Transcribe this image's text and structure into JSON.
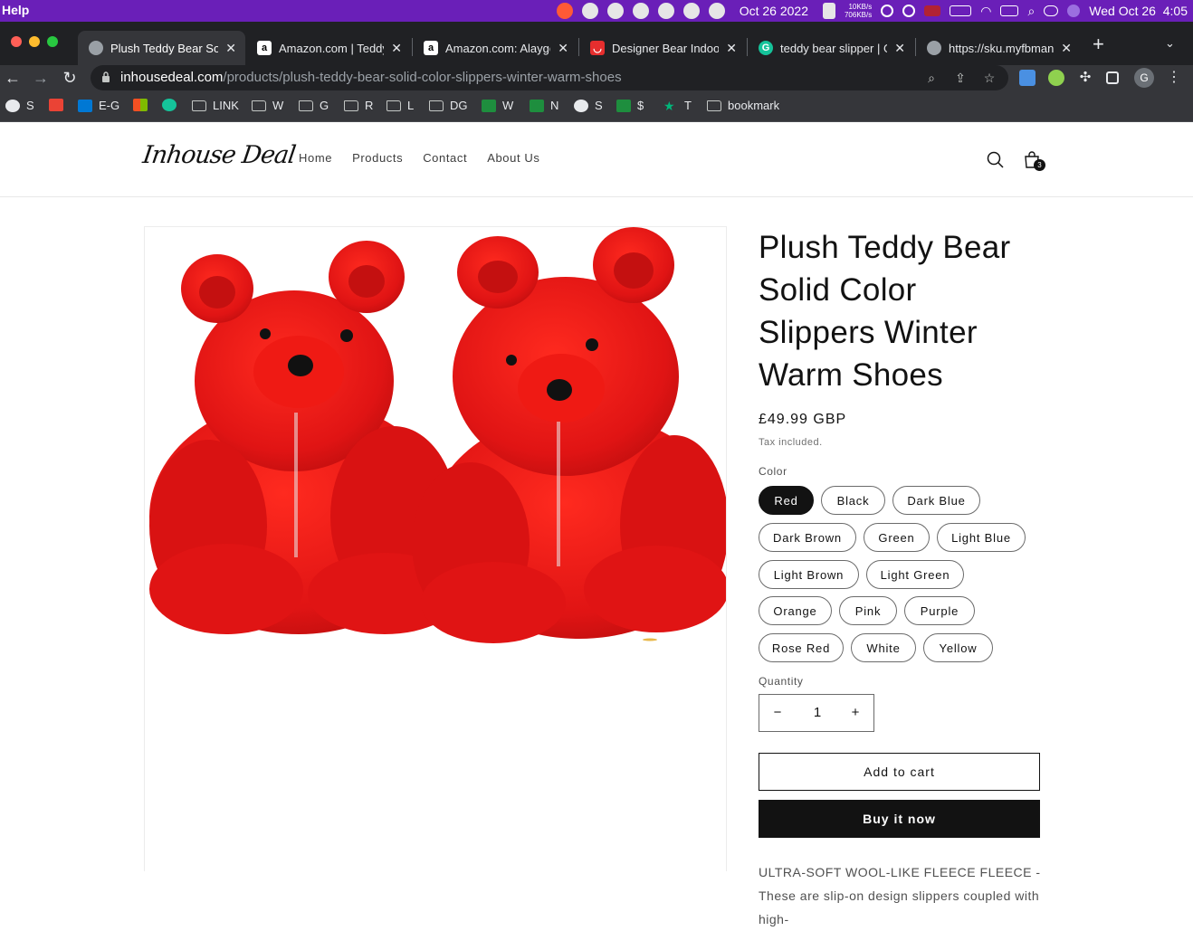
{
  "menubar": {
    "app_menu": [
      "Help"
    ],
    "date_text": "Oct 26 2022",
    "net_up": "10KB/s",
    "net_down": "706KB/s",
    "clock": "Wed Oct 26  4:05"
  },
  "browser": {
    "tabs": [
      {
        "title": "Plush Teddy Bear Solid Color Slippers",
        "icon": "globe-icon"
      },
      {
        "title": "Amazon.com | Teddy Bear Slippers",
        "icon": "amazon-icon"
      },
      {
        "title": "Amazon.com: Alaygee Teddy",
        "icon": "amazon-icon"
      },
      {
        "title": "Designer Bear Indoor Slippers",
        "icon": "shop-icon"
      },
      {
        "title": "teddy bear slipper | Google",
        "icon": "grammarly-icon"
      },
      {
        "title": "https://sku.myfbmanager",
        "icon": "globe-icon"
      }
    ],
    "url_domain": "inhousedeal.com",
    "url_path": "/products/plush-teddy-bear-solid-color-slippers-winter-warm-shoes",
    "profile_initial": "G",
    "bookmarks": [
      "S",
      "",
      "E-G",
      "",
      "",
      "LINK",
      "W",
      "G",
      "R",
      "L",
      "DG",
      "W",
      "N",
      "S",
      "$",
      "T",
      "bookmark"
    ]
  },
  "site": {
    "logo": "Inhouse Deal",
    "nav": [
      "Home",
      "Products",
      "Contact",
      "About Us"
    ],
    "cart_count": "3"
  },
  "product": {
    "title": "Plush Teddy Bear Solid Color Slippers Winter Warm Shoes",
    "price": "£49.99 GBP",
    "tax_note": "Tax included.",
    "color_label": "Color",
    "colors": [
      "Red",
      "Black",
      "Dark Blue",
      "Dark Brown",
      "Green",
      "Light Blue",
      "Light Brown",
      "Light Green",
      "Orange",
      "Pink",
      "Purple",
      "Rose Red",
      "White",
      "Yellow"
    ],
    "selected_color": "Red",
    "quantity_label": "Quantity",
    "quantity": "1",
    "minus": "−",
    "plus": "+",
    "add_to_cart": "Add to cart",
    "buy_now": "Buy it now",
    "description": "ULTRA-SOFT WOOL-LIKE FLEECE FLEECE - These are slip-on design slippers coupled with high-"
  },
  "colors": {
    "menubar": "#6a1fb8",
    "tabbar": "#202124",
    "toolbar": "#35363a",
    "accent_dark": "#121212",
    "product_red": "#e01414"
  }
}
